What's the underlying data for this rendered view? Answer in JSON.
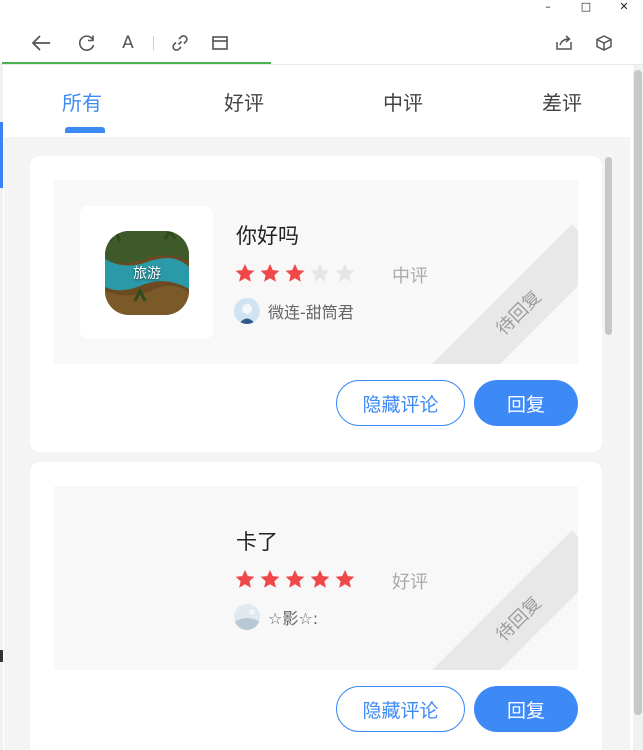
{
  "window": {
    "minimize_glyph": "–",
    "maximize_glyph": "□",
    "close_glyph": "✕"
  },
  "toolbar": {
    "icons": [
      "back-icon",
      "refresh-icon",
      "font-icon",
      "link-icon",
      "window-icon",
      "share-icon",
      "cube-icon"
    ],
    "font_glyph": "A"
  },
  "tabs": [
    {
      "label": "所有",
      "active": true
    },
    {
      "label": "好评",
      "active": false
    },
    {
      "label": "中评",
      "active": false
    },
    {
      "label": "差评",
      "active": false
    }
  ],
  "reviews": [
    {
      "thumbnail_label": "旅游",
      "title": "你好吗",
      "rating": 3,
      "max_rating": 5,
      "rating_label": "中评",
      "user_name": "微连-甜筒君",
      "status": "待回复",
      "hide_button": "隐藏评论",
      "reply_button": "回复"
    },
    {
      "thumbnail_label": "",
      "title": "卡了",
      "rating": 5,
      "max_rating": 5,
      "rating_label": "好评",
      "user_name": "☆影☆:",
      "status": "待回复",
      "hide_button": "隐藏评论",
      "reply_button": "回复"
    }
  ],
  "colors": {
    "accent": "#3d8af7",
    "star_on": "#f04848",
    "star_off": "#e6e6e6",
    "progress": "#4caf50"
  }
}
